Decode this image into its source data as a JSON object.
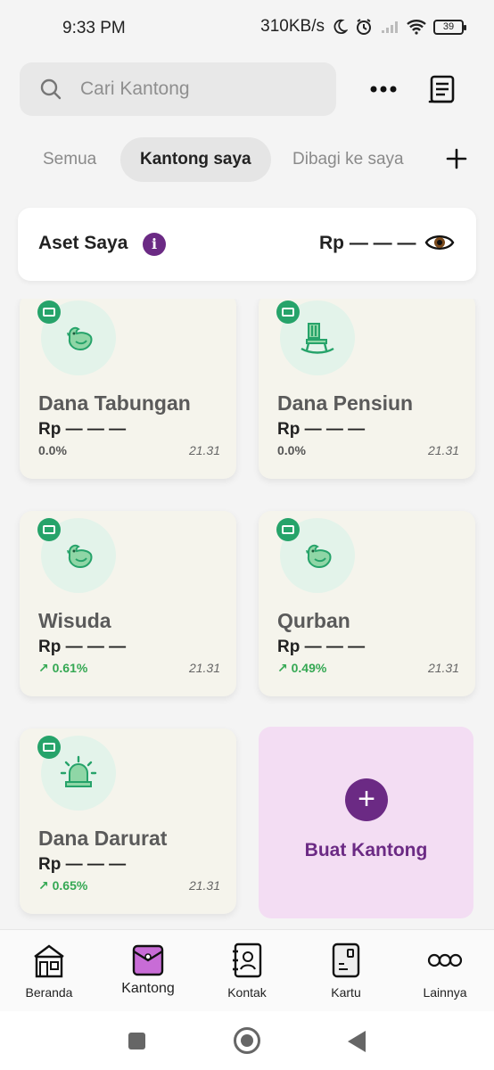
{
  "status_bar": {
    "time": "9:33 PM",
    "network_speed": "310KB/s",
    "battery": "39"
  },
  "search": {
    "placeholder": "Cari Kantong"
  },
  "tabs": [
    {
      "label": "Semua"
    },
    {
      "label": "Kantong saya"
    },
    {
      "label": "Dibagi ke saya"
    }
  ],
  "asset": {
    "title": "Aset Saya",
    "info": "i",
    "amount": "Rp — — —"
  },
  "pockets": [
    {
      "name": "Dana Tabungan",
      "amount": "Rp — — —",
      "percent": "0.0%",
      "time": "21.31",
      "icon": "chicken-icon",
      "trend": "flat"
    },
    {
      "name": "Dana Pensiun",
      "amount": "Rp — — —",
      "percent": "0.0%",
      "time": "21.31",
      "icon": "rocking-chair-icon",
      "trend": "flat"
    },
    {
      "name": "Wisuda",
      "amount": "Rp — — —",
      "percent": "↗ 0.61%",
      "time": "21.31",
      "icon": "chicken-icon",
      "trend": "up"
    },
    {
      "name": "Qurban",
      "amount": "Rp — — —",
      "percent": "↗ 0.49%",
      "time": "21.31",
      "icon": "chicken-icon",
      "trend": "up"
    },
    {
      "name": "Dana Darurat",
      "amount": "Rp — — —",
      "percent": "↗ 0.65%",
      "time": "21.31",
      "icon": "siren-icon",
      "trend": "up"
    }
  ],
  "create_pocket": {
    "label": "Buat Kantong",
    "plus": "+"
  },
  "bottom_nav": [
    {
      "label": "Beranda",
      "icon": "home-icon"
    },
    {
      "label": "Kantong",
      "icon": "pocket-icon"
    },
    {
      "label": "Kontak",
      "icon": "contact-book-icon"
    },
    {
      "label": "Kartu",
      "icon": "card-icon"
    },
    {
      "label": "Lainnya",
      "icon": "more-circles-icon"
    }
  ],
  "colors": {
    "brand_purple": "#6b2a84",
    "green": "#26a36a",
    "card_bg": "#f5f4ec",
    "create_bg": "#f3ddf3"
  }
}
